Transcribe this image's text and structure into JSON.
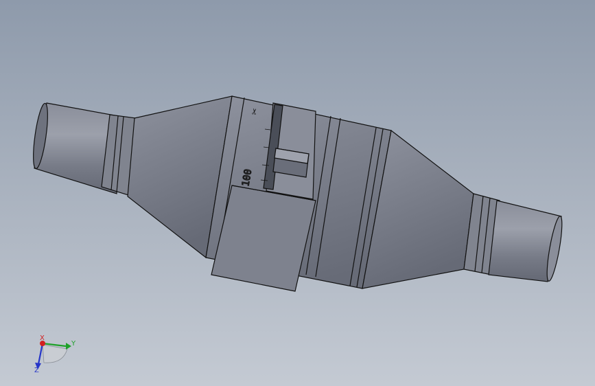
{
  "viewport": {
    "background_top": "#8e9aab",
    "background_bottom": "#c4cad3"
  },
  "model": {
    "body_color": "#7b7f8c",
    "body_light": "#9a9ea9",
    "body_dark": "#5f636f",
    "edge_color": "#111111",
    "engraving_text": "100",
    "scale_symbol": "✂"
  },
  "triad": {
    "x_label": "X",
    "y_label": "Y",
    "z_label": "Z",
    "x_color": "#d22020",
    "y_color": "#1fa12a",
    "z_color": "#2636c8"
  }
}
